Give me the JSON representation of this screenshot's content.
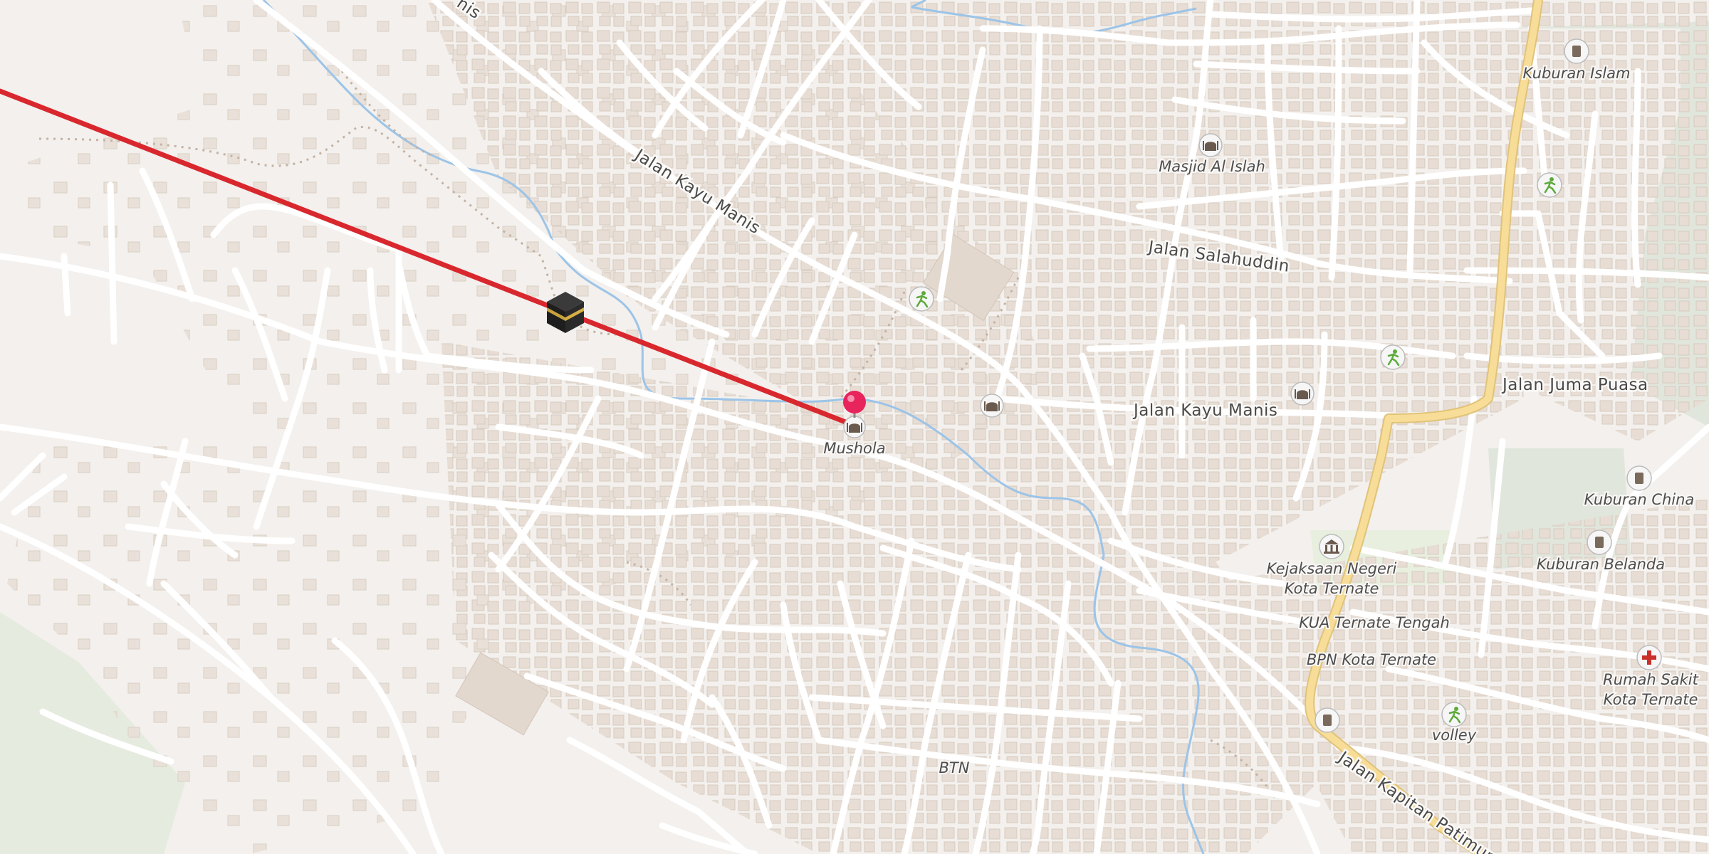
{
  "map": {
    "streets": [
      {
        "label": "Jalan Kayu Manis",
        "id": "kayu-manis-nw"
      },
      {
        "label": "Jalan Kayu Manis",
        "id": "kayu-manis-e"
      },
      {
        "label": "Jalan Salahuddin",
        "id": "salahuddin"
      },
      {
        "label": "Jalan Juma Puasa",
        "id": "juma-puasa"
      },
      {
        "label": "Jalan Kapitan Patimura",
        "id": "kapitan-patimura"
      },
      {
        "label": "nis",
        "id": "cut-off-top"
      }
    ],
    "areas": [
      {
        "label": "BTN"
      }
    ],
    "pois": [
      {
        "label": "Mushola",
        "icon": "mosque-icon"
      },
      {
        "label": "Masjid Al Islah",
        "icon": "mosque-icon"
      },
      {
        "label": "Kuburan Islam",
        "icon": "cemetery-icon"
      },
      {
        "label": "Kuburan China",
        "icon": "cemetery-icon"
      },
      {
        "label": "Kuburan Belanda",
        "icon": "cemetery-icon"
      },
      {
        "label": "Kejaksaan Negeri",
        "label2": "Kota Ternate",
        "icon": "government-building-icon"
      },
      {
        "label": "KUA Ternate Tengah"
      },
      {
        "label": "BPN Kota Ternate"
      },
      {
        "label": "volley",
        "icon": "sports-icon"
      },
      {
        "label": "Rumah Sakit",
        "label2": "Kota Ternate",
        "icon": "hospital-icon"
      }
    ],
    "markers": {
      "kaaba": {
        "icon": "kaaba-icon"
      },
      "location_pin": {
        "icon": "location-pin-icon"
      }
    },
    "colors": {
      "qibla_line": "#d9272e",
      "pin": "#e8245c",
      "main_road": "#f5d98a",
      "water": "#9cc4e8"
    }
  }
}
